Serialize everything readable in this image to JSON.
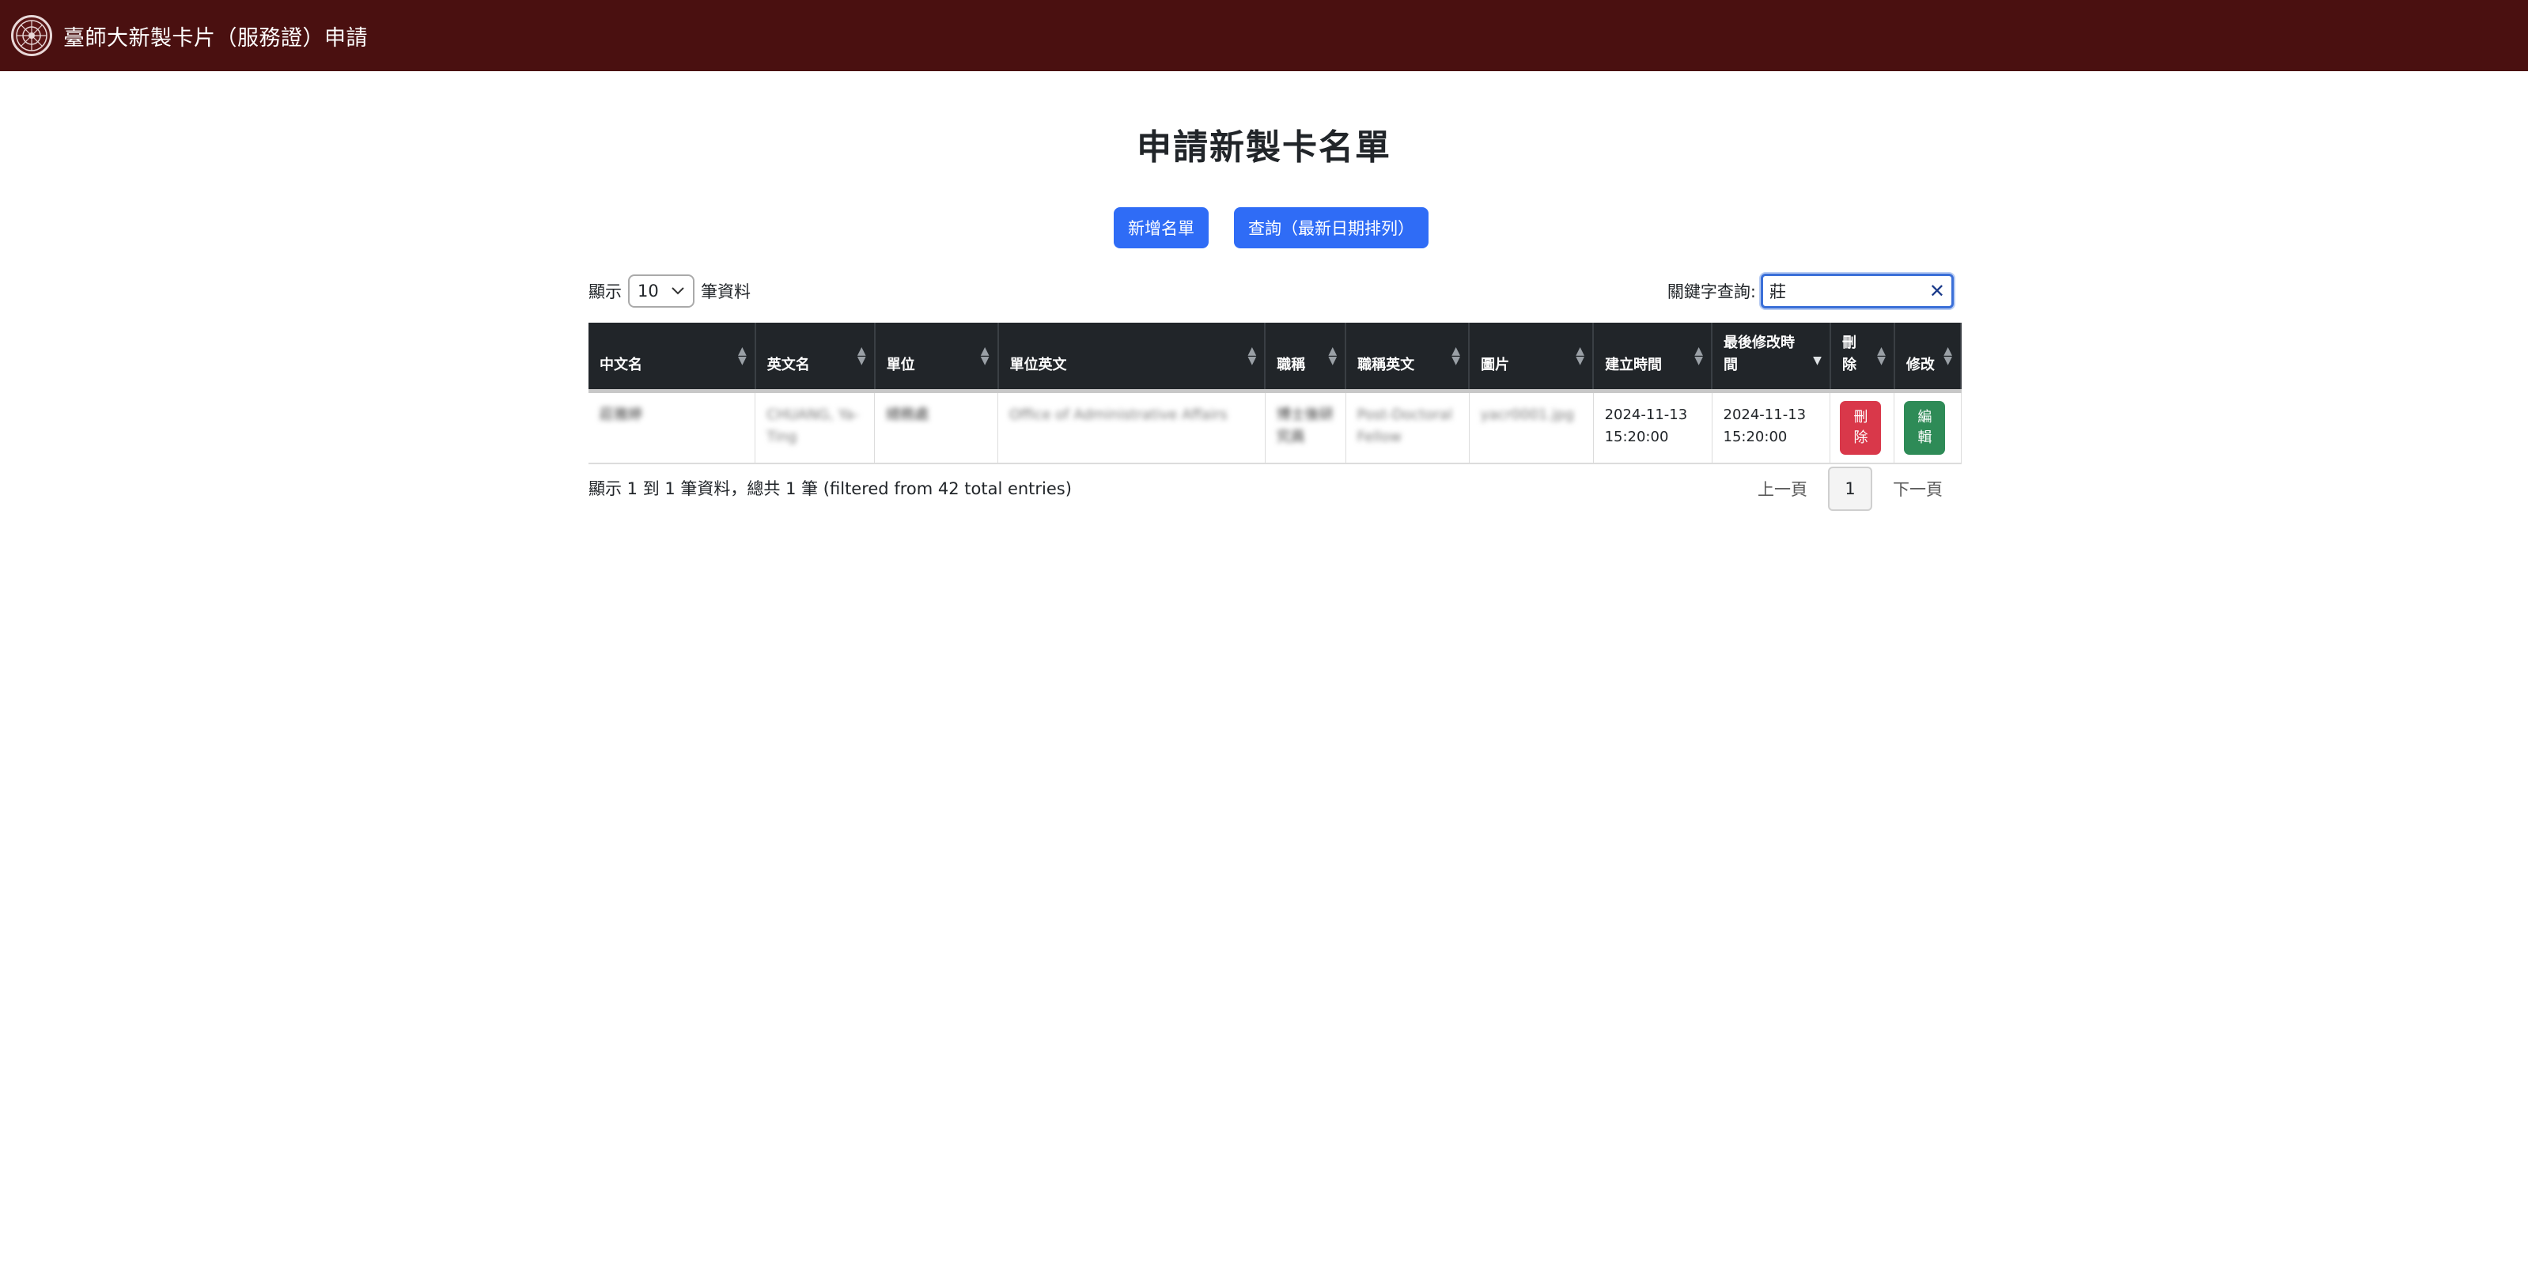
{
  "header": {
    "title": "臺師大新製卡片（服務證）申請"
  },
  "page": {
    "title": "申請新製卡名單"
  },
  "actions": {
    "add_label": "新增名單",
    "query_label": "查詢（最新日期排列）"
  },
  "length": {
    "prefix": "顯示",
    "value": "10",
    "suffix": "筆資料"
  },
  "search": {
    "label": "關鍵字查詢:",
    "value": "莊"
  },
  "table": {
    "columns": [
      "中文名",
      "英文名",
      "單位",
      "單位英文",
      "職稱",
      "職稱英文",
      "圖片",
      "建立時間",
      "最後修改時間",
      "刪除",
      "修改"
    ],
    "rows": [
      {
        "cn_name": "莊雅婷",
        "en_name": "CHUANG, Ya-Ting",
        "unit": "總務處",
        "unit_en": "Office of Administrative Affairs",
        "title": "博士後研究員",
        "title_en": "Post-Doctoral Fellow",
        "image": "yacr0001.jpg",
        "created": "2024-11-13 15:20:00",
        "modified": "2024-11-13 15:20:00",
        "delete_label": "刪除",
        "edit_label": "編輯"
      }
    ]
  },
  "footer": {
    "info": "顯示 1 到 1 筆資料，總共 1 筆 (filtered from 42 total entries)",
    "prev": "上一頁",
    "page": "1",
    "next": "下一頁"
  },
  "colors": {
    "navbar": "#4a1010",
    "primary": "#2f6cf6",
    "danger": "#d9384a",
    "success": "#2e8b57",
    "table_head": "#212529"
  }
}
